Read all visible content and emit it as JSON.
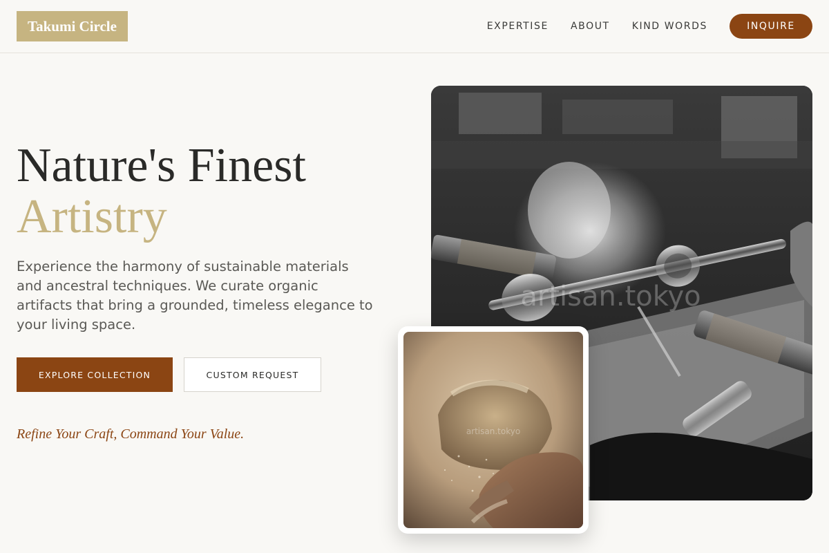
{
  "header": {
    "logo": "Takumi Circle",
    "nav": [
      "EXPERTISE",
      "ABOUT",
      "KIND WORDS"
    ],
    "cta": "INQUIRE"
  },
  "hero": {
    "title_line1": "Nature's Finest",
    "title_line2": "Artistry",
    "description": "Experience the harmony of sustainable materials and ancestral techniques. We curate organic artifacts that bring a grounded, timeless elegance to your living space.",
    "primary_button": "EXPLORE COLLECTION",
    "secondary_button": "CUSTOM REQUEST",
    "tagline": "Refine Your Craft, Command Your Value."
  },
  "images": {
    "main_watermark": "artisan.tokyo",
    "small_watermark": "artisan.tokyo"
  },
  "colors": {
    "accent_brown": "#8b4513",
    "accent_gold": "#c6b481",
    "background": "#f9f8f5"
  }
}
